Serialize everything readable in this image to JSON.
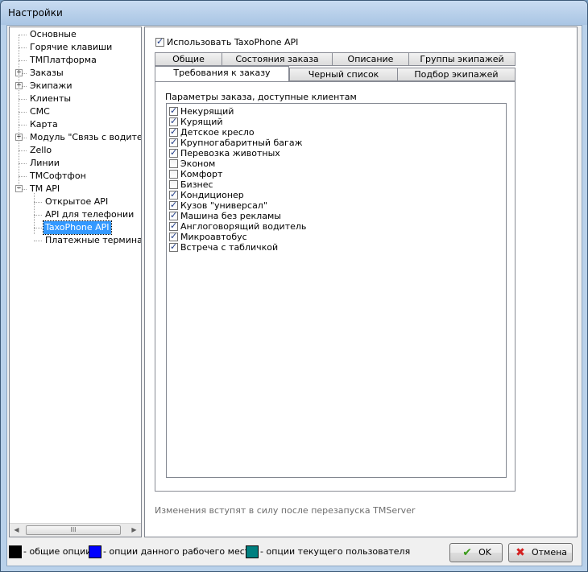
{
  "window": {
    "title": "Настройки"
  },
  "tree": {
    "items": [
      {
        "label": "Основные",
        "level": 0,
        "expander": ""
      },
      {
        "label": "Горячие клавиши",
        "level": 0,
        "expander": ""
      },
      {
        "label": "ТМПлатформа",
        "level": 0,
        "expander": ""
      },
      {
        "label": "Заказы",
        "level": 0,
        "expander": "+"
      },
      {
        "label": "Экипажи",
        "level": 0,
        "expander": "+"
      },
      {
        "label": "Клиенты",
        "level": 0,
        "expander": ""
      },
      {
        "label": "СМС",
        "level": 0,
        "expander": ""
      },
      {
        "label": "Карта",
        "level": 0,
        "expander": ""
      },
      {
        "label": "Модуль \"Связь с водителем\"",
        "level": 0,
        "expander": "+"
      },
      {
        "label": "Zello",
        "level": 0,
        "expander": ""
      },
      {
        "label": "Линии",
        "level": 0,
        "expander": ""
      },
      {
        "label": "ТМСофтфон",
        "level": 0,
        "expander": ""
      },
      {
        "label": "TM API",
        "level": 0,
        "expander": "−"
      },
      {
        "label": "Открытое API",
        "level": 1,
        "expander": ""
      },
      {
        "label": "API для телефонии",
        "level": 1,
        "expander": ""
      },
      {
        "label": "TaxoPhone API",
        "level": 1,
        "expander": "",
        "selected": true
      },
      {
        "label": "Платежные терминалы",
        "level": 1,
        "expander": ""
      }
    ],
    "scroll_grip": "III"
  },
  "settings": {
    "use_api_label": "Использовать TaxoPhone API",
    "use_api_checked": true,
    "tabs_row1": [
      "Общие",
      "Состояния заказа",
      "Описание",
      "Группы экипажей"
    ],
    "tabs_row2": [
      "Требования к заказу",
      "Черный список",
      "Подбор экипажей"
    ],
    "active_tab": "Требования к заказу",
    "group_label": "Параметры заказа, доступные клиентам",
    "params": [
      {
        "label": "Некурящий",
        "checked": true
      },
      {
        "label": "Курящий",
        "checked": true
      },
      {
        "label": "Детское кресло",
        "checked": true
      },
      {
        "label": "Крупногабаритный багаж",
        "checked": true
      },
      {
        "label": "Перевозка животных",
        "checked": true
      },
      {
        "label": "Эконом",
        "checked": false
      },
      {
        "label": "Комфорт",
        "checked": false
      },
      {
        "label": "Бизнес",
        "checked": false
      },
      {
        "label": "Кондиционер",
        "checked": true
      },
      {
        "label": "Кузов \"универсал\"",
        "checked": true
      },
      {
        "label": "Машина без рекламы",
        "checked": true
      },
      {
        "label": "Англоговорящий водитель",
        "checked": true
      },
      {
        "label": "Микроавтобус",
        "checked": true
      },
      {
        "label": "Встреча с табличкой",
        "checked": true
      }
    ],
    "note": "Изменения вступят в силу после перезапуска TMServer"
  },
  "legend": [
    {
      "label": "- общие опции",
      "color": "#000000"
    },
    {
      "label": "- опции данного рабочего места",
      "color": "#0000ff"
    },
    {
      "label": "- опции текущего пользователя",
      "color": "#008080"
    }
  ],
  "buttons": {
    "ok": "OK",
    "cancel": "Отмена"
  },
  "colors": {
    "ok_icon": "#3a9a1a",
    "cancel_icon": "#d42020",
    "selection": "#3399ff"
  }
}
